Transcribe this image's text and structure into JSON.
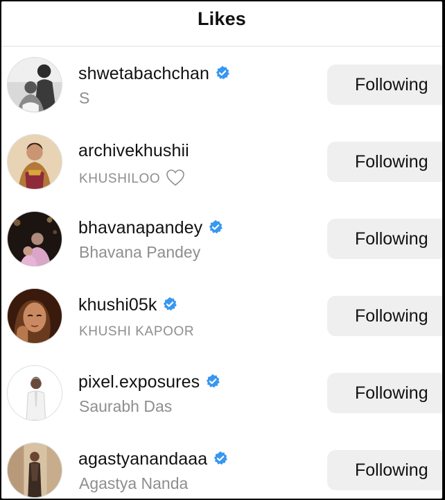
{
  "header": {
    "title": "Likes"
  },
  "users": [
    {
      "username": "shwetabachchan",
      "verified": true,
      "subtitle": "S",
      "subtitle_style": "normal",
      "button_label": "Following"
    },
    {
      "username": "archivekhushii",
      "verified": false,
      "subtitle": "KHUSHILOO",
      "subtitle_style": "caps",
      "subtitle_icon": "heart-outline-icon",
      "button_label": "Following"
    },
    {
      "username": "bhavanapandey",
      "verified": true,
      "subtitle": "Bhavana Pandey",
      "subtitle_style": "normal",
      "button_label": "Following"
    },
    {
      "username": "khushi05k",
      "verified": true,
      "subtitle": "KHUSHI KAPOOR",
      "subtitle_style": "caps",
      "button_label": "Following"
    },
    {
      "username": "pixel.exposures",
      "verified": true,
      "subtitle": "Saurabh Das",
      "subtitle_style": "normal",
      "button_label": "Following"
    },
    {
      "username": "agastyanandaaa",
      "verified": true,
      "subtitle": "Agastya Nanda",
      "subtitle_style": "normal",
      "button_label": "Following"
    }
  ],
  "colors": {
    "verified_badge": "#3897f0",
    "button_bg": "#efefef",
    "subtitle": "#8e8e8e"
  }
}
